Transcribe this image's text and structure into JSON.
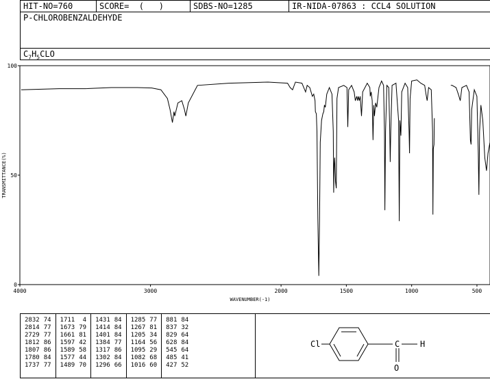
{
  "header": {
    "hit_no": "HIT-NO=760",
    "score": "SCORE=  (   )",
    "sdbs_no": "SDBS-NO=1285",
    "ir_nida": "IR-NIDA-07863 : CCL4 SOLUTION"
  },
  "compound_name": "P-CHLOROBENZALDEHYDE",
  "formula": {
    "c": "C",
    "c_sub": "7",
    "h": "H",
    "h_sub": "5",
    "rest": "CLO"
  },
  "chart_data": {
    "type": "line",
    "xlabel": "WAVENUMBER(-1)",
    "ylabel": "TRANSMITTANCE(%)",
    "xlim": [
      4000,
      400
    ],
    "ylim": [
      0,
      100
    ],
    "x_ticks": [
      "4000",
      "3000",
      "2000",
      "1500",
      "1000",
      "500"
    ],
    "y_ticks": [
      "0",
      "50",
      "100"
    ],
    "series": [
      {
        "points": [
          [
            3990,
            89
          ],
          [
            3700,
            89.5
          ],
          [
            3500,
            89.5
          ],
          [
            3300,
            90
          ],
          [
            3100,
            90
          ],
          [
            2990,
            89.8
          ],
          [
            2920,
            89
          ],
          [
            2870,
            85
          ],
          [
            2850,
            80
          ],
          [
            2832,
            74
          ],
          [
            2820,
            79
          ],
          [
            2814,
            77
          ],
          [
            2790,
            83
          ],
          [
            2760,
            84
          ],
          [
            2740,
            80
          ],
          [
            2729,
            77
          ],
          [
            2710,
            83
          ],
          [
            2640,
            91
          ],
          [
            2400,
            92
          ],
          [
            2100,
            92.5
          ],
          [
            1950,
            92
          ],
          [
            1930,
            90
          ],
          [
            1912,
            89
          ],
          [
            1890,
            92.5
          ],
          [
            1840,
            92
          ],
          [
            1812,
            88
          ],
          [
            1800,
            91
          ],
          [
            1780,
            90
          ],
          [
            1760,
            86
          ],
          [
            1750,
            87
          ],
          [
            1740,
            84
          ],
          [
            1737,
            79
          ],
          [
            1730,
            78
          ],
          [
            1725,
            70
          ],
          [
            1718,
            30
          ],
          [
            1711,
            4
          ],
          [
            1705,
            30
          ],
          [
            1700,
            65
          ],
          [
            1690,
            75
          ],
          [
            1680,
            78
          ],
          [
            1673,
            79
          ],
          [
            1668,
            82
          ],
          [
            1661,
            81
          ],
          [
            1650,
            87
          ],
          [
            1630,
            90
          ],
          [
            1610,
            87
          ],
          [
            1600,
            70
          ],
          [
            1597,
            42
          ],
          [
            1593,
            55
          ],
          [
            1589,
            58
          ],
          [
            1583,
            47
          ],
          [
            1577,
            44
          ],
          [
            1572,
            85
          ],
          [
            1560,
            90
          ],
          [
            1520,
            91
          ],
          [
            1495,
            90
          ],
          [
            1489,
            72
          ],
          [
            1482,
            89
          ],
          [
            1460,
            91
          ],
          [
            1440,
            88
          ],
          [
            1431,
            84
          ],
          [
            1420,
            86
          ],
          [
            1414,
            84
          ],
          [
            1408,
            86
          ],
          [
            1401,
            84
          ],
          [
            1394,
            86
          ],
          [
            1384,
            77
          ],
          [
            1375,
            88
          ],
          [
            1340,
            92
          ],
          [
            1320,
            90
          ],
          [
            1317,
            86
          ],
          [
            1310,
            88
          ],
          [
            1302,
            84
          ],
          [
            1298,
            72
          ],
          [
            1296,
            66
          ],
          [
            1290,
            82
          ],
          [
            1285,
            77
          ],
          [
            1276,
            83
          ],
          [
            1267,
            81
          ],
          [
            1250,
            90
          ],
          [
            1230,
            93
          ],
          [
            1215,
            91
          ],
          [
            1208,
            70
          ],
          [
            1205,
            34
          ],
          [
            1200,
            70
          ],
          [
            1190,
            91
          ],
          [
            1175,
            90
          ],
          [
            1168,
            70
          ],
          [
            1164,
            56
          ],
          [
            1160,
            70
          ],
          [
            1150,
            91
          ],
          [
            1120,
            92
          ],
          [
            1100,
            75
          ],
          [
            1095,
            29
          ],
          [
            1090,
            75
          ],
          [
            1082,
            68
          ],
          [
            1076,
            88
          ],
          [
            1050,
            92
          ],
          [
            1030,
            90
          ],
          [
            1020,
            70
          ],
          [
            1016,
            60
          ],
          [
            1012,
            85
          ],
          [
            1000,
            93
          ],
          [
            960,
            93.5
          ],
          [
            930,
            92
          ],
          [
            900,
            91
          ],
          [
            890,
            87
          ],
          [
            881,
            84
          ],
          [
            870,
            90
          ],
          [
            850,
            89
          ],
          [
            840,
            70
          ],
          [
            837,
            32
          ],
          [
            834,
            62
          ],
          [
            829,
            64
          ],
          [
            826,
            76
          ],
          [
            700,
            91
          ],
          [
            690,
            91
          ],
          [
            660,
            90
          ],
          [
            640,
            86.5
          ],
          [
            628,
            84
          ],
          [
            615,
            90
          ],
          [
            580,
            91
          ],
          [
            560,
            88
          ],
          [
            550,
            66
          ],
          [
            545,
            64
          ],
          [
            540,
            80
          ],
          [
            520,
            89
          ],
          [
            500,
            86
          ],
          [
            490,
            60
          ],
          [
            485,
            41
          ],
          [
            480,
            70
          ],
          [
            470,
            82
          ],
          [
            455,
            75
          ],
          [
            440,
            58
          ],
          [
            427,
            52
          ],
          [
            415,
            60
          ],
          [
            400,
            65
          ]
        ]
      }
    ]
  },
  "peak_table": [
    [
      [
        "2832",
        "74"
      ],
      [
        "2814",
        "77"
      ],
      [
        "2729",
        "77"
      ],
      [
        "1812",
        "86"
      ],
      [
        "1807",
        "86"
      ],
      [
        "1780",
        "84"
      ],
      [
        "1737",
        "77"
      ]
    ],
    [
      [
        "1711",
        "4"
      ],
      [
        "1673",
        "79"
      ],
      [
        "1661",
        "81"
      ],
      [
        "1597",
        "42"
      ],
      [
        "1589",
        "58"
      ],
      [
        "1577",
        "44"
      ],
      [
        "1489",
        "70"
      ]
    ],
    [
      [
        "1431",
        "84"
      ],
      [
        "1414",
        "84"
      ],
      [
        "1401",
        "84"
      ],
      [
        "1384",
        "77"
      ],
      [
        "1317",
        "86"
      ],
      [
        "1302",
        "84"
      ],
      [
        "1296",
        "66"
      ]
    ],
    [
      [
        "1285",
        "77"
      ],
      [
        "1267",
        "81"
      ],
      [
        "1205",
        "34"
      ],
      [
        "1164",
        "56"
      ],
      [
        "1095",
        "29"
      ],
      [
        "1082",
        "68"
      ],
      [
        "1016",
        "60"
      ]
    ],
    [
      [
        "881",
        "84"
      ],
      [
        "837",
        "32"
      ],
      [
        "829",
        "64"
      ],
      [
        "628",
        "84"
      ],
      [
        "545",
        "64"
      ],
      [
        "485",
        "41"
      ],
      [
        "427",
        "52"
      ]
    ]
  ],
  "structure": {
    "cl_label": "Cl",
    "c_label": "C",
    "h_label": "H",
    "o_label": "O"
  }
}
